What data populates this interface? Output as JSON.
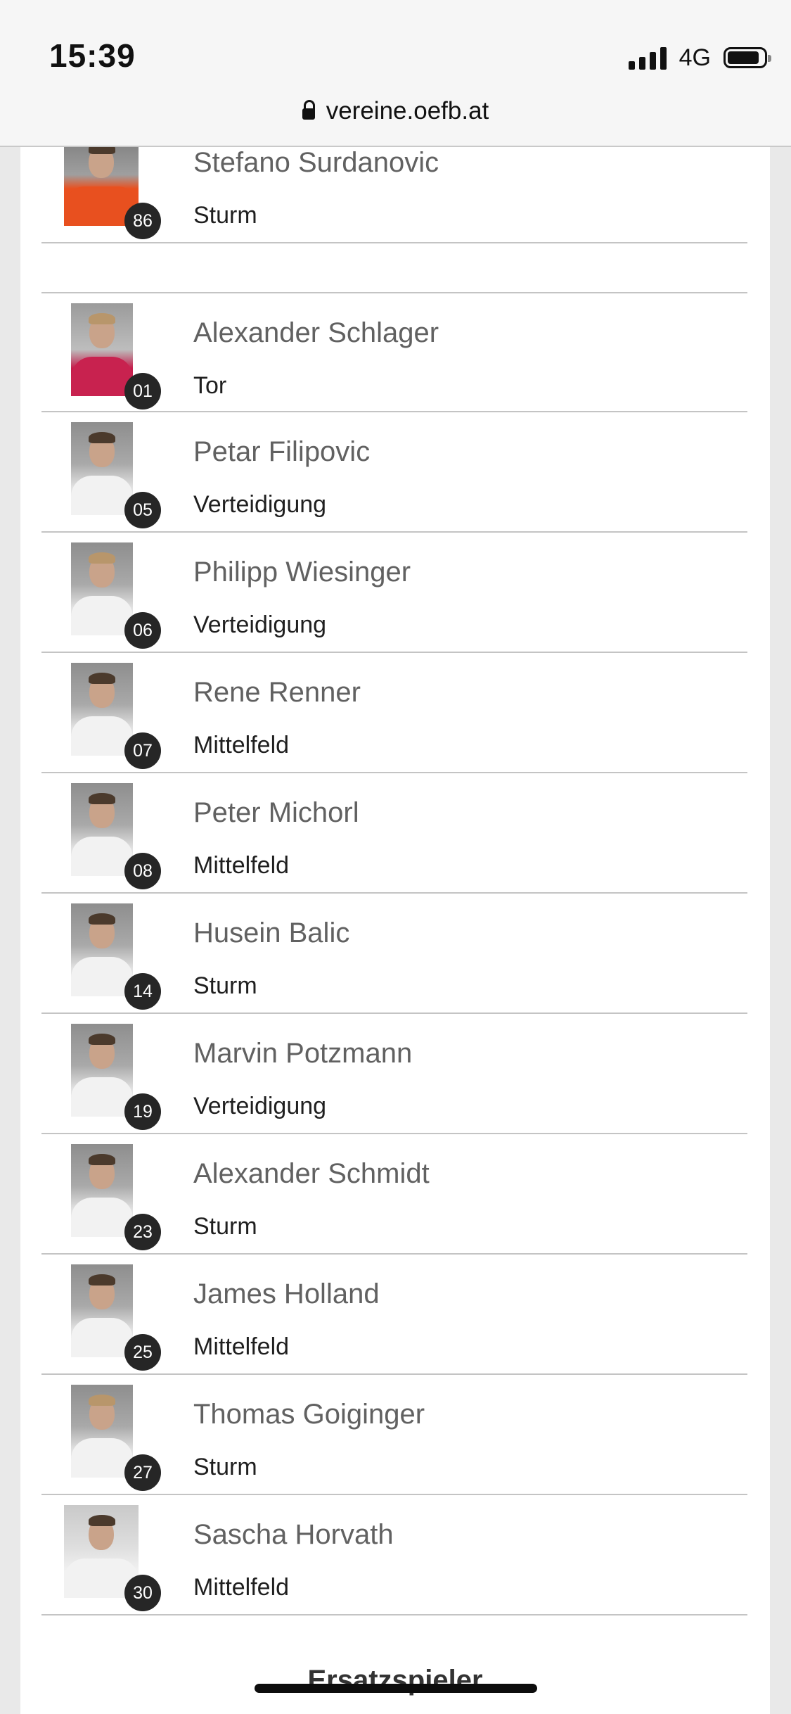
{
  "status_bar": {
    "time": "15:39",
    "network": "4G"
  },
  "browser": {
    "url": "vereine.oefb.at"
  },
  "players_top": [
    {
      "name": "Stefano Surdanovic",
      "position": "Sturm",
      "number": "86"
    }
  ],
  "players_main": [
    {
      "name": "Alexander Schlager",
      "position": "Tor",
      "number": "01"
    },
    {
      "name": "Petar Filipovic",
      "position": "Verteidigung",
      "number": "05"
    },
    {
      "name": "Philipp Wiesinger",
      "position": "Verteidigung",
      "number": "06"
    },
    {
      "name": "Rene Renner",
      "position": "Mittelfeld",
      "number": "07"
    },
    {
      "name": "Peter Michorl",
      "position": "Mittelfeld",
      "number": "08"
    },
    {
      "name": "Husein Balic",
      "position": "Sturm",
      "number": "14"
    },
    {
      "name": "Marvin Potzmann",
      "position": "Verteidigung",
      "number": "19"
    },
    {
      "name": "Alexander Schmidt",
      "position": "Sturm",
      "number": "23"
    },
    {
      "name": "James Holland",
      "position": "Mittelfeld",
      "number": "25"
    },
    {
      "name": "Thomas Goiginger",
      "position": "Sturm",
      "number": "27"
    },
    {
      "name": "Sascha Horvath",
      "position": "Mittelfeld",
      "number": "30"
    }
  ],
  "next_section": {
    "heading": "Ersatzspieler"
  }
}
